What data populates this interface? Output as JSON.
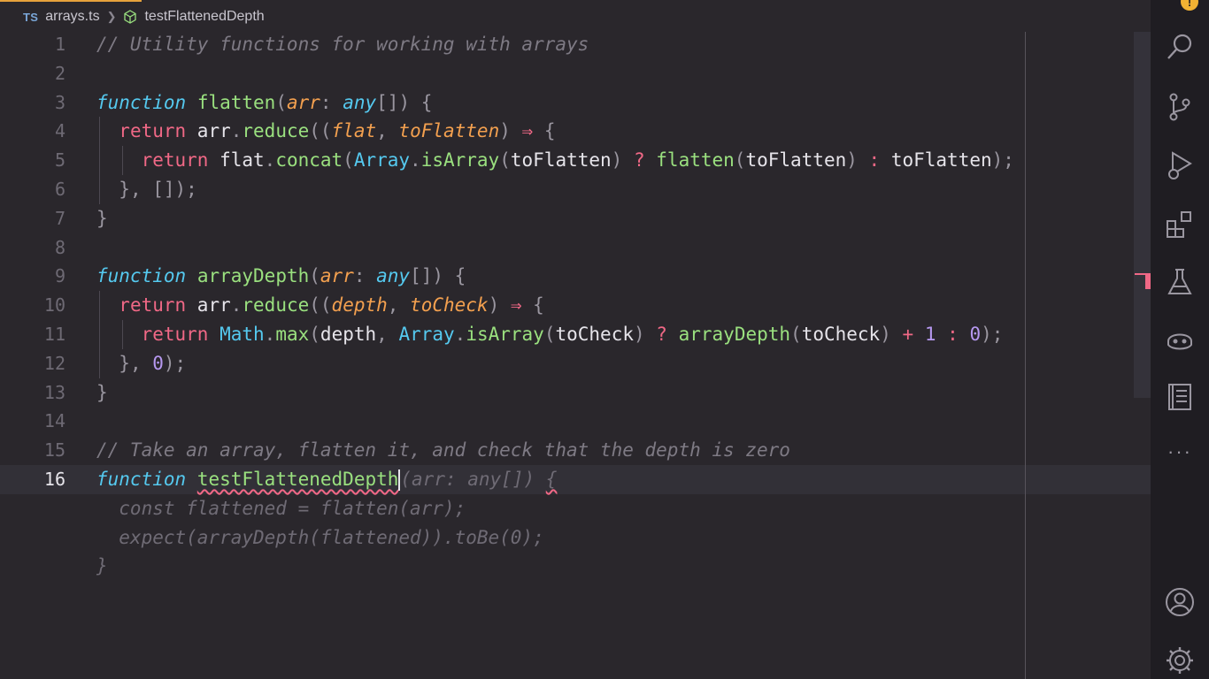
{
  "breadcrumb": {
    "lang_badge": "TS",
    "file": "arrays.ts",
    "symbol": "testFlattenedDepth"
  },
  "activity_bar": {
    "notification_count": "!",
    "icons": [
      "files-icon",
      "search-icon",
      "source-control-icon",
      "run-debug-icon",
      "extensions-icon",
      "testing-icon",
      "copilot-icon",
      "notebook-icon",
      "more-icon",
      "account-icon",
      "settings-gear-icon"
    ],
    "more_label": "···"
  },
  "editor": {
    "current_line": 16,
    "lines": [
      {
        "n": "1",
        "tokens": [
          [
            "cm",
            "// Utility functions for working with arrays"
          ]
        ]
      },
      {
        "n": "2",
        "tokens": []
      },
      {
        "n": "3",
        "tokens": [
          [
            "kw",
            "function"
          ],
          [
            "id",
            " "
          ],
          [
            "fn",
            "flatten"
          ],
          [
            "pu",
            "("
          ],
          [
            "pm",
            "arr"
          ],
          [
            "pu",
            ": "
          ],
          [
            "ty",
            "any"
          ],
          [
            "pu",
            "[]) {"
          ]
        ]
      },
      {
        "n": "4",
        "tokens": [
          [
            "id",
            "  "
          ],
          [
            "rt",
            "return"
          ],
          [
            "id",
            " arr"
          ],
          [
            "pu",
            "."
          ],
          [
            "fn",
            "reduce"
          ],
          [
            "pu",
            "(("
          ],
          [
            "pm",
            "flat"
          ],
          [
            "pu",
            ", "
          ],
          [
            "pm",
            "toFlatten"
          ],
          [
            "pu",
            ") "
          ],
          [
            "op",
            "⇒"
          ],
          [
            "pu",
            " {"
          ]
        ]
      },
      {
        "n": "5",
        "tokens": [
          [
            "id",
            "    "
          ],
          [
            "rt",
            "return"
          ],
          [
            "id",
            " flat"
          ],
          [
            "pu",
            "."
          ],
          [
            "fn",
            "concat"
          ],
          [
            "pu",
            "("
          ],
          [
            "cls",
            "Array"
          ],
          [
            "pu",
            "."
          ],
          [
            "fn",
            "isArray"
          ],
          [
            "pu",
            "("
          ],
          [
            "id",
            "toFlatten"
          ],
          [
            "pu",
            ") "
          ],
          [
            "op",
            "?"
          ],
          [
            "id",
            " "
          ],
          [
            "fn",
            "flatten"
          ],
          [
            "pu",
            "("
          ],
          [
            "id",
            "toFlatten"
          ],
          [
            "pu",
            ") "
          ],
          [
            "op",
            ":"
          ],
          [
            "id",
            " toFlatten"
          ],
          [
            "pu",
            ");"
          ]
        ]
      },
      {
        "n": "6",
        "tokens": [
          [
            "id",
            "  "
          ],
          [
            "pu",
            "}, []);"
          ]
        ]
      },
      {
        "n": "7",
        "tokens": [
          [
            "pu",
            "}"
          ]
        ]
      },
      {
        "n": "8",
        "tokens": []
      },
      {
        "n": "9",
        "tokens": [
          [
            "kw",
            "function"
          ],
          [
            "id",
            " "
          ],
          [
            "fn",
            "arrayDepth"
          ],
          [
            "pu",
            "("
          ],
          [
            "pm",
            "arr"
          ],
          [
            "pu",
            ": "
          ],
          [
            "ty",
            "any"
          ],
          [
            "pu",
            "[]) {"
          ]
        ]
      },
      {
        "n": "10",
        "tokens": [
          [
            "id",
            "  "
          ],
          [
            "rt",
            "return"
          ],
          [
            "id",
            " arr"
          ],
          [
            "pu",
            "."
          ],
          [
            "fn",
            "reduce"
          ],
          [
            "pu",
            "(("
          ],
          [
            "pm",
            "depth"
          ],
          [
            "pu",
            ", "
          ],
          [
            "pm",
            "toCheck"
          ],
          [
            "pu",
            ") "
          ],
          [
            "op",
            "⇒"
          ],
          [
            "pu",
            " {"
          ]
        ]
      },
      {
        "n": "11",
        "tokens": [
          [
            "id",
            "    "
          ],
          [
            "rt",
            "return"
          ],
          [
            "id",
            " "
          ],
          [
            "cls",
            "Math"
          ],
          [
            "pu",
            "."
          ],
          [
            "fn",
            "max"
          ],
          [
            "pu",
            "("
          ],
          [
            "id",
            "depth"
          ],
          [
            "pu",
            ", "
          ],
          [
            "cls",
            "Array"
          ],
          [
            "pu",
            "."
          ],
          [
            "fn",
            "isArray"
          ],
          [
            "pu",
            "("
          ],
          [
            "id",
            "toCheck"
          ],
          [
            "pu",
            ") "
          ],
          [
            "op",
            "?"
          ],
          [
            "id",
            " "
          ],
          [
            "fn",
            "arrayDepth"
          ],
          [
            "pu",
            "("
          ],
          [
            "id",
            "toCheck"
          ],
          [
            "pu",
            ") "
          ],
          [
            "op",
            "+"
          ],
          [
            "id",
            " "
          ],
          [
            "nm",
            "1"
          ],
          [
            "id",
            " "
          ],
          [
            "op",
            ":"
          ],
          [
            "id",
            " "
          ],
          [
            "nm",
            "0"
          ],
          [
            "pu",
            ");"
          ]
        ]
      },
      {
        "n": "12",
        "tokens": [
          [
            "id",
            "  "
          ],
          [
            "pu",
            "}, "
          ],
          [
            "nm",
            "0"
          ],
          [
            "pu",
            ");"
          ]
        ]
      },
      {
        "n": "13",
        "tokens": [
          [
            "pu",
            "}"
          ]
        ]
      },
      {
        "n": "14",
        "tokens": []
      },
      {
        "n": "15",
        "tokens": [
          [
            "cm",
            "// Take an array, flatten it, and check that the depth is zero"
          ]
        ]
      },
      {
        "n": "16",
        "tokens": [
          [
            "kw",
            "function"
          ],
          [
            "id",
            " "
          ],
          [
            "fn sq",
            "testFlattenedDepth"
          ],
          [
            "cursor",
            ""
          ],
          [
            "ghost",
            "(arr: any[]) "
          ],
          [
            "ghost sq",
            "{"
          ]
        ]
      },
      {
        "n": "",
        "tokens": [
          [
            "ghost",
            "  const flattened = flatten(arr);"
          ]
        ]
      },
      {
        "n": "",
        "tokens": [
          [
            "ghost",
            "  expect(arrayDepth(flattened)).toBe(0);"
          ]
        ]
      },
      {
        "n": "",
        "tokens": [
          [
            "ghost",
            "}"
          ]
        ]
      }
    ]
  }
}
